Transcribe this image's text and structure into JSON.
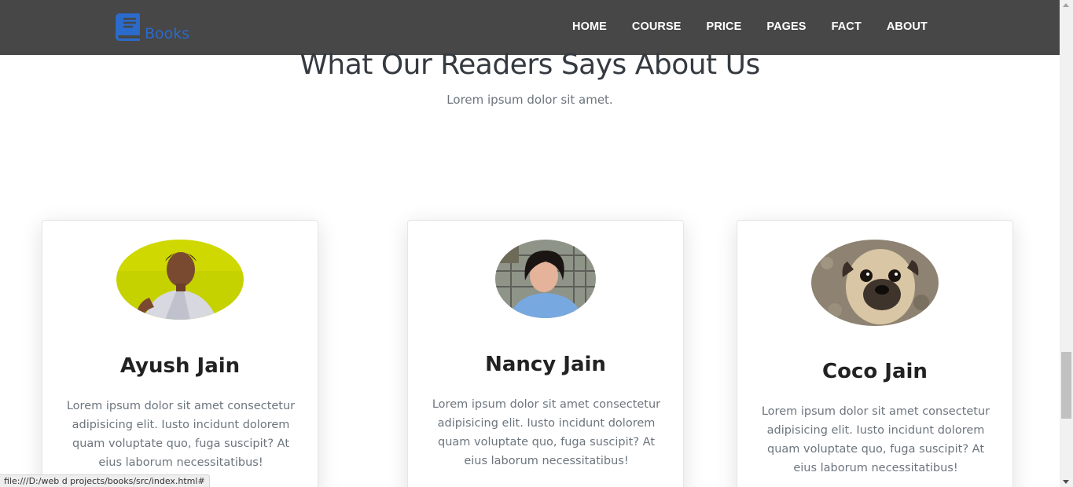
{
  "brand": {
    "name": "Books",
    "color": "#2a6bcc",
    "icon": "book-icon"
  },
  "nav": {
    "items": [
      "HOME",
      "COURSE",
      "PRICE",
      "PAGES",
      "FACT",
      "ABOUT"
    ]
  },
  "section": {
    "title": "What Our Readers Says About Us",
    "subtitle": "Lorem ipsum dolor sit amet."
  },
  "testimonials": [
    {
      "name": "Ayush Jain",
      "text": "Lorem ipsum dolor sit amet consectetur adipisicing elit. Iusto incidunt dolorem quam voluptate quo, fuga suscipit? At eius laborum necessitatibus!"
    },
    {
      "name": "Nancy Jain",
      "text": "Lorem ipsum dolor sit amet consectetur adipisicing elit. Iusto incidunt dolorem quam voluptate quo, fuga suscipit? At eius laborum necessitatibus!"
    },
    {
      "name": "Coco Jain",
      "text": "Lorem ipsum dolor sit amet consectetur adipisicing elit. Iusto incidunt dolorem quam voluptate quo, fuga suscipit? At eius laborum necessitatibus!"
    }
  ],
  "status_bar": {
    "url": "file:///D:/web d projects/books/src/index.html#"
  }
}
